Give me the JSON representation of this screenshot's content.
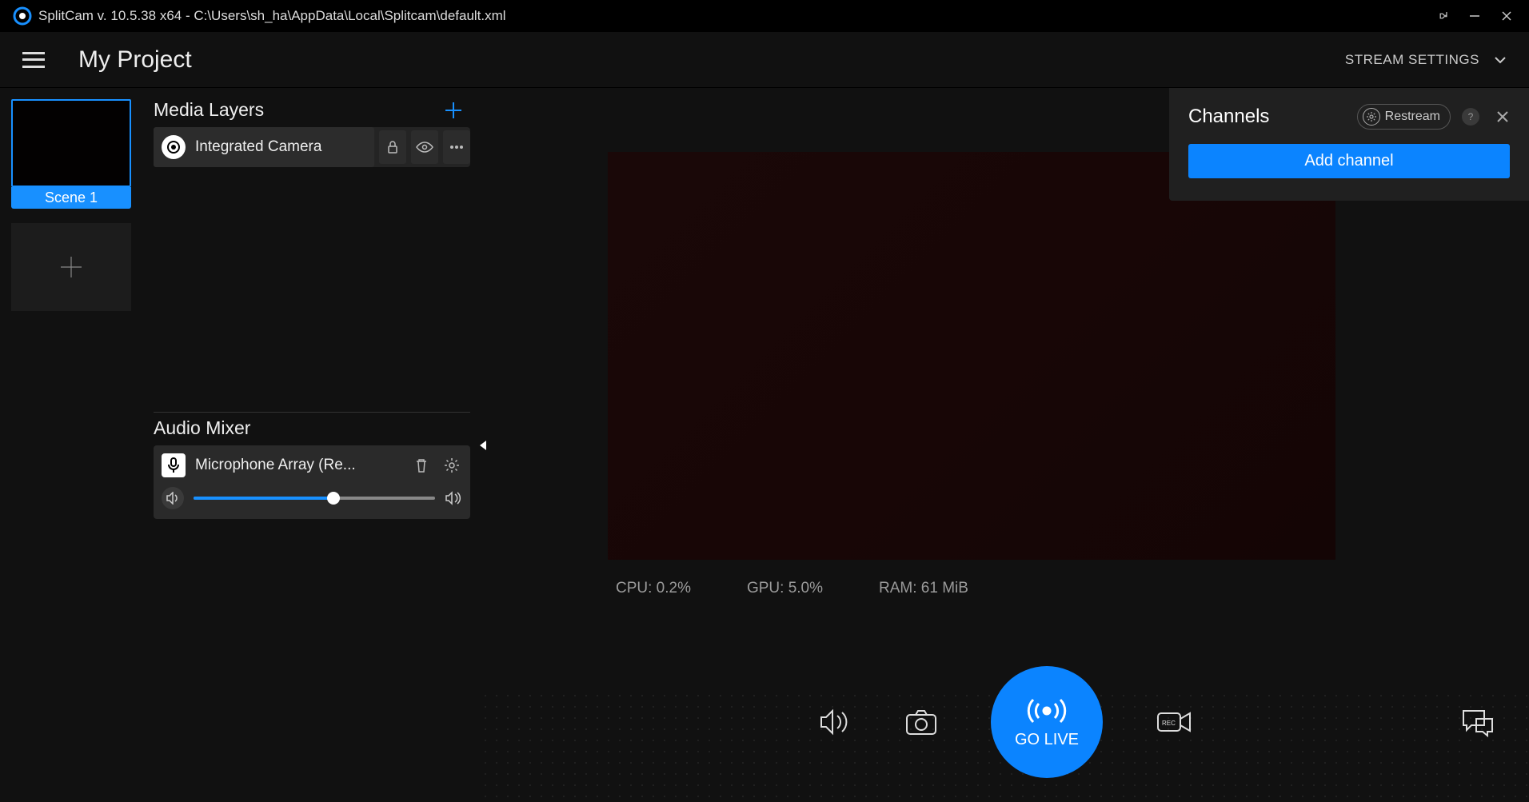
{
  "titlebar": {
    "title": "SplitCam v. 10.5.38 x64 - C:\\Users\\sh_ha\\AppData\\Local\\Splitcam\\default.xml"
  },
  "header": {
    "project_title": "My Project",
    "stream_settings": "STREAM SETTINGS"
  },
  "scenes": {
    "items": [
      {
        "label": "Scene 1"
      }
    ]
  },
  "media_layers": {
    "title": "Media Layers",
    "items": [
      {
        "name": "Integrated Camera"
      }
    ]
  },
  "audio_mixer": {
    "title": "Audio Mixer",
    "items": [
      {
        "name": "Microphone  Array  (Re...",
        "level_percent": 58
      }
    ]
  },
  "stats": {
    "cpu": "CPU: 0.2%",
    "gpu": "GPU: 5.0%",
    "ram": "RAM: 61 MiB"
  },
  "bottombar": {
    "golive": "GO LIVE"
  },
  "channels": {
    "title": "Channels",
    "restream_label": "Restream",
    "add_button": "Add channel"
  }
}
